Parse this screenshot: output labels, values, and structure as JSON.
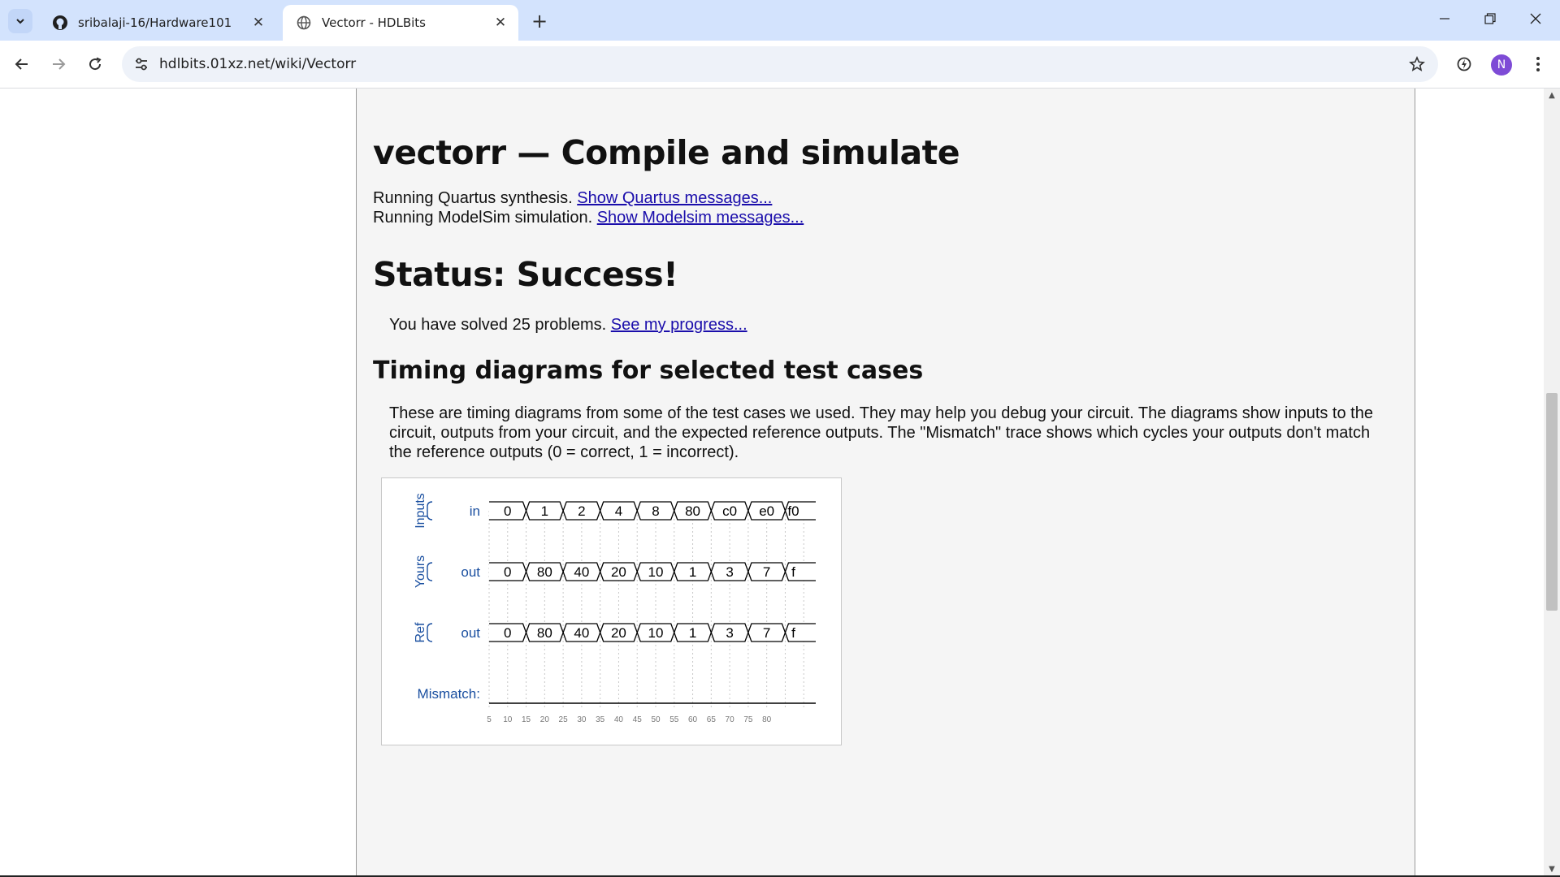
{
  "browser": {
    "tabs": [
      {
        "title": "sribalaji-16/Hardware101",
        "icon": "github-icon"
      },
      {
        "title": "Vectorr - HDLBits",
        "icon": "globe-icon"
      }
    ],
    "url": "hdlbits.01xz.net/wiki/Vectorr",
    "avatar_letter": "N"
  },
  "page": {
    "title": "vectorr — Compile and simulate",
    "quartus_text": "Running Quartus synthesis.",
    "quartus_link": "Show Quartus messages...",
    "modelsim_text": "Running ModelSim simulation.",
    "modelsim_link": "Show Modelsim messages...",
    "status": "Status: Success!",
    "solved_text": "You have solved 25 problems.",
    "progress_link": "See my progress...",
    "timing_heading": "Timing diagrams for selected test cases",
    "timing_desc": "These are timing diagrams from some of the test cases we used. They may help you debug your circuit. The diagrams show inputs to the circuit, outputs from your circuit, and the expected reference outputs. The \"Mismatch\" trace shows which cycles your outputs don't match the reference outputs (0 = correct, 1 = incorrect)."
  },
  "timing_diagram": {
    "groups": [
      "Inputs",
      "Yours",
      "Ref"
    ],
    "rows": [
      {
        "group": "Inputs",
        "signal": "in",
        "values": [
          "0",
          "1",
          "2",
          "4",
          "8",
          "80",
          "c0",
          "e0",
          "f0"
        ]
      },
      {
        "group": "Yours",
        "signal": "out",
        "values": [
          "0",
          "80",
          "40",
          "20",
          "10",
          "1",
          "3",
          "7",
          "f"
        ]
      },
      {
        "group": "Ref",
        "signal": "out",
        "values": [
          "0",
          "80",
          "40",
          "20",
          "10",
          "1",
          "3",
          "7",
          "f"
        ]
      }
    ],
    "mismatch_label": "Mismatch:",
    "time_ticks": [
      "5",
      "10",
      "15",
      "20",
      "25",
      "30",
      "35",
      "40",
      "45",
      "50",
      "55",
      "60",
      "65",
      "70",
      "75",
      "80"
    ],
    "colors": {
      "label": "#1a4fa0",
      "grid": "#c8c8c8",
      "trace": "#000000"
    }
  }
}
